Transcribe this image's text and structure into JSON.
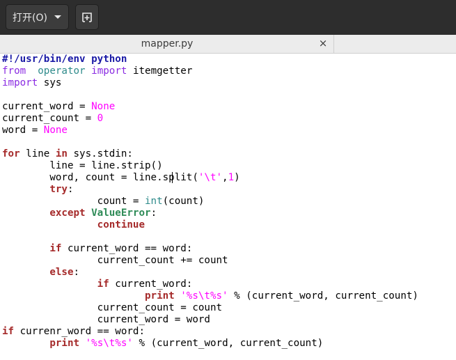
{
  "toolbar": {
    "open_label": "打开(O)",
    "open_menu_icon": "chevron-down-icon",
    "new_document_icon": "new-document-icon"
  },
  "tab": {
    "title": "mapper.py",
    "close_glyph": "×"
  },
  "editor": {
    "lines": [
      [
        [
          "pp",
          "#!/usr/bin/env python"
        ]
      ],
      [
        [
          "imp",
          "from"
        ],
        [
          "",
          "  "
        ],
        [
          "mod",
          "operator"
        ],
        [
          "",
          " "
        ],
        [
          "imp",
          "import"
        ],
        [
          "",
          " itemgetter"
        ]
      ],
      [
        [
          "imp",
          "import"
        ],
        [
          "",
          " sys"
        ]
      ],
      [],
      [
        [
          "",
          "current_word = "
        ],
        [
          "const",
          "None"
        ]
      ],
      [
        [
          "",
          "current_count = "
        ],
        [
          "num",
          "0"
        ]
      ],
      [
        [
          "",
          "word = "
        ],
        [
          "const",
          "None"
        ]
      ],
      [],
      [
        [
          "kw",
          "for"
        ],
        [
          "",
          " line "
        ],
        [
          "kw",
          "in"
        ],
        [
          "",
          " sys.stdin:"
        ]
      ],
      [
        [
          "",
          "        line = line.strip()"
        ]
      ],
      [
        [
          "",
          "        word, count = line.split("
        ],
        [
          "str",
          "'\\t'"
        ],
        [
          "",
          ","
        ],
        [
          "num",
          "1"
        ],
        [
          "",
          ")"
        ]
      ],
      [
        [
          "",
          "        "
        ],
        [
          "kw",
          "try"
        ],
        [
          "",
          ":"
        ]
      ],
      [
        [
          "",
          "                count = "
        ],
        [
          "bi",
          "int"
        ],
        [
          "",
          "(count)"
        ]
      ],
      [
        [
          "",
          "        "
        ],
        [
          "kw",
          "except"
        ],
        [
          "",
          " "
        ],
        [
          "exc",
          "ValueError"
        ],
        [
          "",
          ":"
        ]
      ],
      [
        [
          "",
          "                "
        ],
        [
          "kw",
          "continue"
        ]
      ],
      [],
      [
        [
          "",
          "        "
        ],
        [
          "kw",
          "if"
        ],
        [
          "",
          " current_word == word:"
        ]
      ],
      [
        [
          "",
          "                current_count += count"
        ]
      ],
      [
        [
          "",
          "        "
        ],
        [
          "kw",
          "else"
        ],
        [
          "",
          ":"
        ]
      ],
      [
        [
          "",
          "                "
        ],
        [
          "kw",
          "if"
        ],
        [
          "",
          " current_word:"
        ]
      ],
      [
        [
          "",
          "                        "
        ],
        [
          "kw",
          "print"
        ],
        [
          "",
          " "
        ],
        [
          "str",
          "'%s\\t%s'"
        ],
        [
          "",
          " % (current_word, current_count)"
        ]
      ],
      [
        [
          "",
          "                current_count = count"
        ]
      ],
      [
        [
          "",
          "                current_word = word"
        ]
      ],
      [
        [
          "kw",
          "if"
        ],
        [
          "",
          " currenr_word == word:"
        ]
      ],
      [
        [
          "",
          "        "
        ],
        [
          "kw",
          "print"
        ],
        [
          "",
          " "
        ],
        [
          "str",
          "'%s\\t%s'"
        ],
        [
          "",
          " % (current_word, current_count)"
        ]
      ]
    ]
  }
}
